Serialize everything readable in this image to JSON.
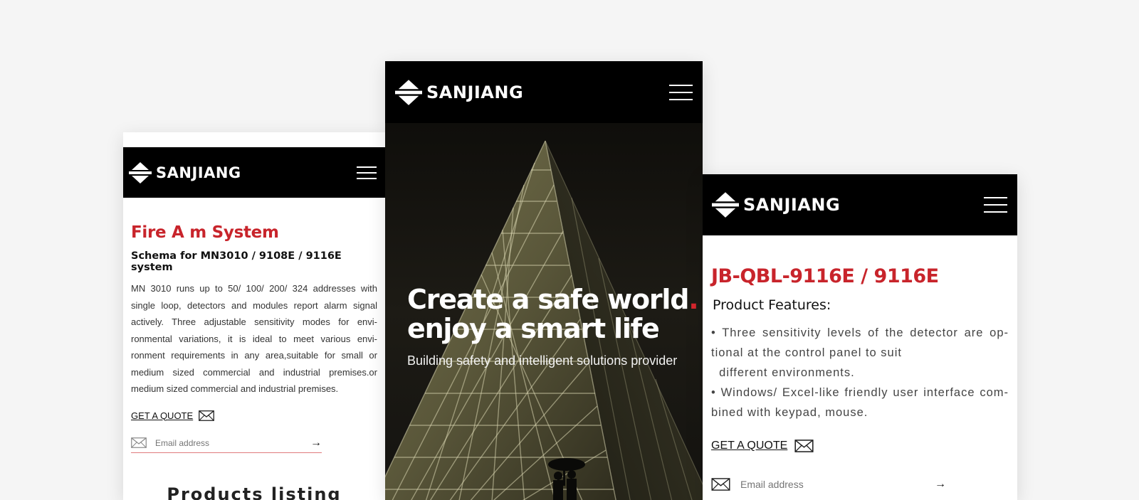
{
  "brand": {
    "name": "SANJIANG"
  },
  "left_screen": {
    "title": "Fire A m System",
    "subtitle": "Schema for MN3010 / 9108E / 9116E system",
    "paragraph": "MN 3010 runs up to 50/ 100/ 200/ 324 addresses with single loop, detectors and modules report alarm signal actively. Three adjustable sensitivity modes for envi-ronmental variations, it is ideal to meet various envi-ronment requirements in any area,suitable for small or medium sized commercial and industrial premises.or medium sized commercial and industrial premises.",
    "quote_label": "GET A QUOTE",
    "email_placeholder": "Email address",
    "submit_arrow": "→",
    "products_heading": "Products listing"
  },
  "center_screen": {
    "headline_line1": "Create a safe world",
    "headline_dot": ".",
    "headline_line2": "enjoy a smart life",
    "tagline": "Building safety and intelligent solutions provider"
  },
  "right_screen": {
    "title": "JB-QBL-9116E / 9116E",
    "subtitle": "Product Features:",
    "features": [
      "• Three sensitivity levels of the detector are op-tional at the control panel to suit",
      "  different environments.",
      "• Windows/ Excel-like friendly user interface com-bined with keypad, mouse."
    ],
    "quote_label": "GET A QUOTE",
    "email_placeholder": "Email address",
    "submit_arrow": "→"
  },
  "colors": {
    "accent_red": "#c8242b",
    "header_black": "#000000",
    "page_bg": "#f5f5f5"
  },
  "icons": [
    "sanjiang-logo-icon",
    "hamburger-menu-icon",
    "envelope-icon",
    "arrow-right-icon"
  ]
}
